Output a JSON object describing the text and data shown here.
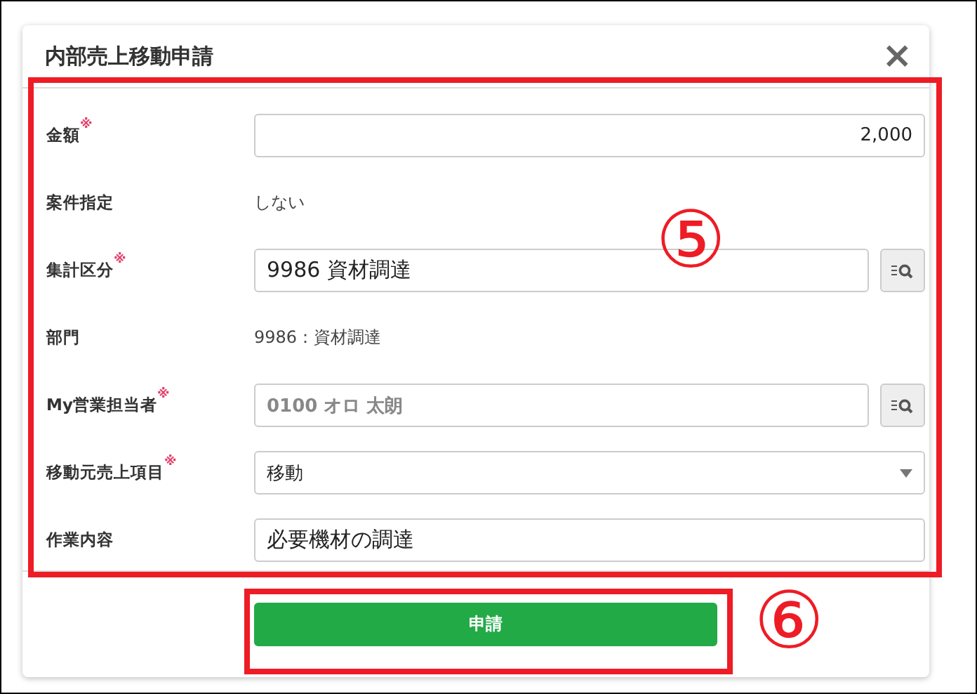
{
  "dialog": {
    "title": "内部売上移動申請",
    "close": "×"
  },
  "rows": [
    {
      "kind": "number",
      "label": "金額",
      "required": true,
      "value": "2,000",
      "disabled": false
    },
    {
      "kind": "static",
      "label": "案件指定",
      "required": false,
      "value": "しない",
      "disabled": false
    },
    {
      "kind": "lookup",
      "label": "集計区分",
      "required": true,
      "value": "9986 資材調達",
      "disabled": false
    },
    {
      "kind": "static",
      "label": "部門",
      "required": false,
      "value": "9986：資材調達",
      "disabled": false
    },
    {
      "kind": "lookup",
      "label": "My営業担当者",
      "required": true,
      "value": "0100 オロ 太朗",
      "disabled": true
    },
    {
      "kind": "select",
      "label": "移動元売上項目",
      "required": true,
      "value": "移動",
      "disabled": false
    },
    {
      "kind": "text",
      "label": "作業内容",
      "required": false,
      "value": "必要機材の調達",
      "disabled": false
    }
  ],
  "required_mark": "※",
  "submit": "申請",
  "annotations": [
    {
      "label": "⑤"
    },
    {
      "label": "⑥"
    }
  ]
}
